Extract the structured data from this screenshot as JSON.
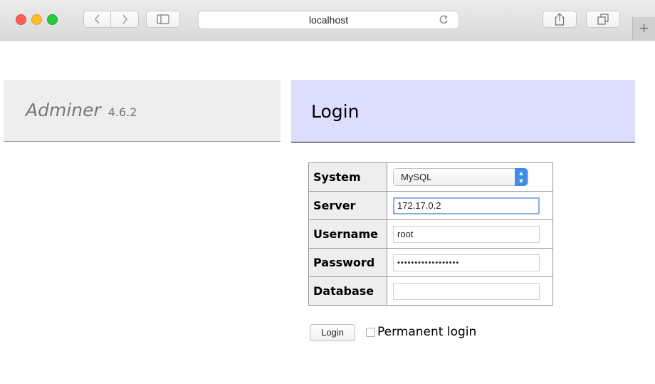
{
  "browser": {
    "address": "localhost",
    "new_tab_label": "+",
    "traffic_lights": {
      "close": "#fc5f57",
      "minimize": "#fdbc2e",
      "zoom": "#28c83f"
    },
    "icons": [
      "chevron-left-icon",
      "chevron-right-icon",
      "sidebar-icon",
      "reload-icon",
      "share-icon",
      "tabs-overview-icon"
    ]
  },
  "brand": {
    "name": "Adminer",
    "version": "4.6.2"
  },
  "login": {
    "title": "Login",
    "fields": {
      "system": {
        "label": "System",
        "value": "MySQL"
      },
      "server": {
        "label": "Server",
        "value": "172.17.0.2"
      },
      "username": {
        "label": "Username",
        "value": "root"
      },
      "password": {
        "label": "Password",
        "value": "••••••••••••••••••"
      },
      "database": {
        "label": "Database",
        "value": ""
      }
    },
    "submit_label": "Login",
    "permanent_label": "Permanent login",
    "permanent_checked": false
  },
  "colors": {
    "brand_bg": "#eeeeee",
    "header_bg": "#ddddff",
    "select_arrow": "#3f8de4",
    "focus_ring": "#87afe2"
  }
}
